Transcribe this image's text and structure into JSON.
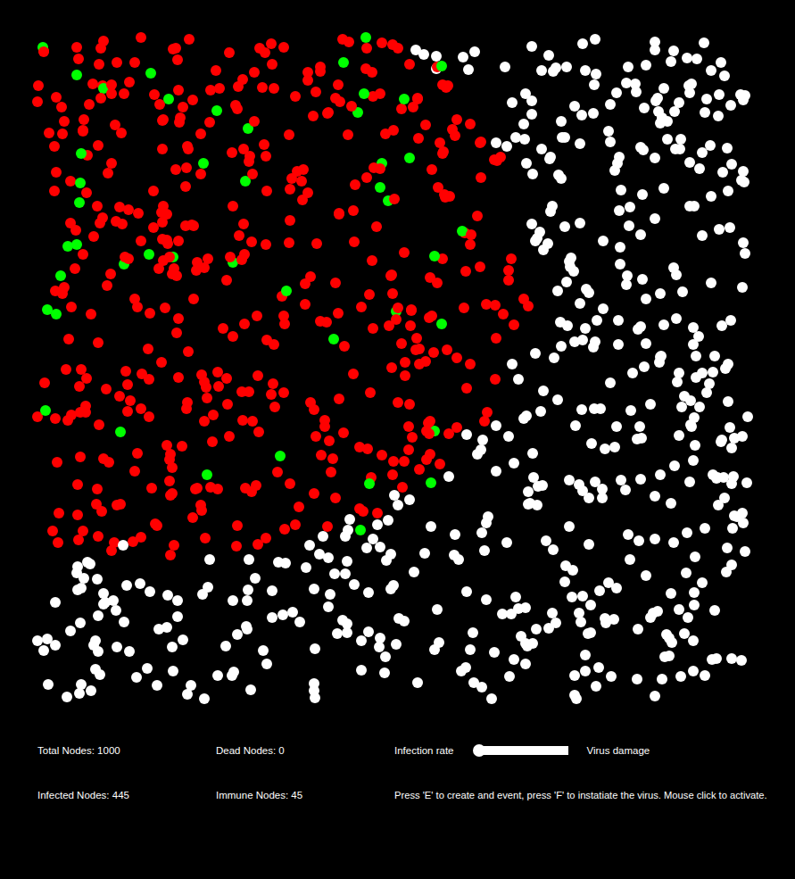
{
  "canvas": {
    "node_kinds": [
      {
        "kind": "infected",
        "count": "445",
        "color": "#ff0000"
      },
      {
        "kind": "immune",
        "count": "45",
        "color": "#00ff00"
      },
      {
        "kind": "healthy",
        "color": "#ffffff"
      }
    ]
  },
  "stats": [
    {
      "label": "Total Nodes:",
      "value": "1000"
    },
    {
      "label": "Dead Nodes:",
      "value": "0"
    },
    {
      "label": "Infected Nodes:",
      "value": "445"
    },
    {
      "label": "Immune Nodes:",
      "value": "45"
    }
  ],
  "controls": [
    {
      "kind": "slider",
      "label": "Infection rate",
      "level": 0
    },
    {
      "kind": "label",
      "label": "Virus damage"
    }
  ],
  "instructions": "Press 'E' to create and event, press 'F' to instatiate the virus. Mouse click to activate."
}
